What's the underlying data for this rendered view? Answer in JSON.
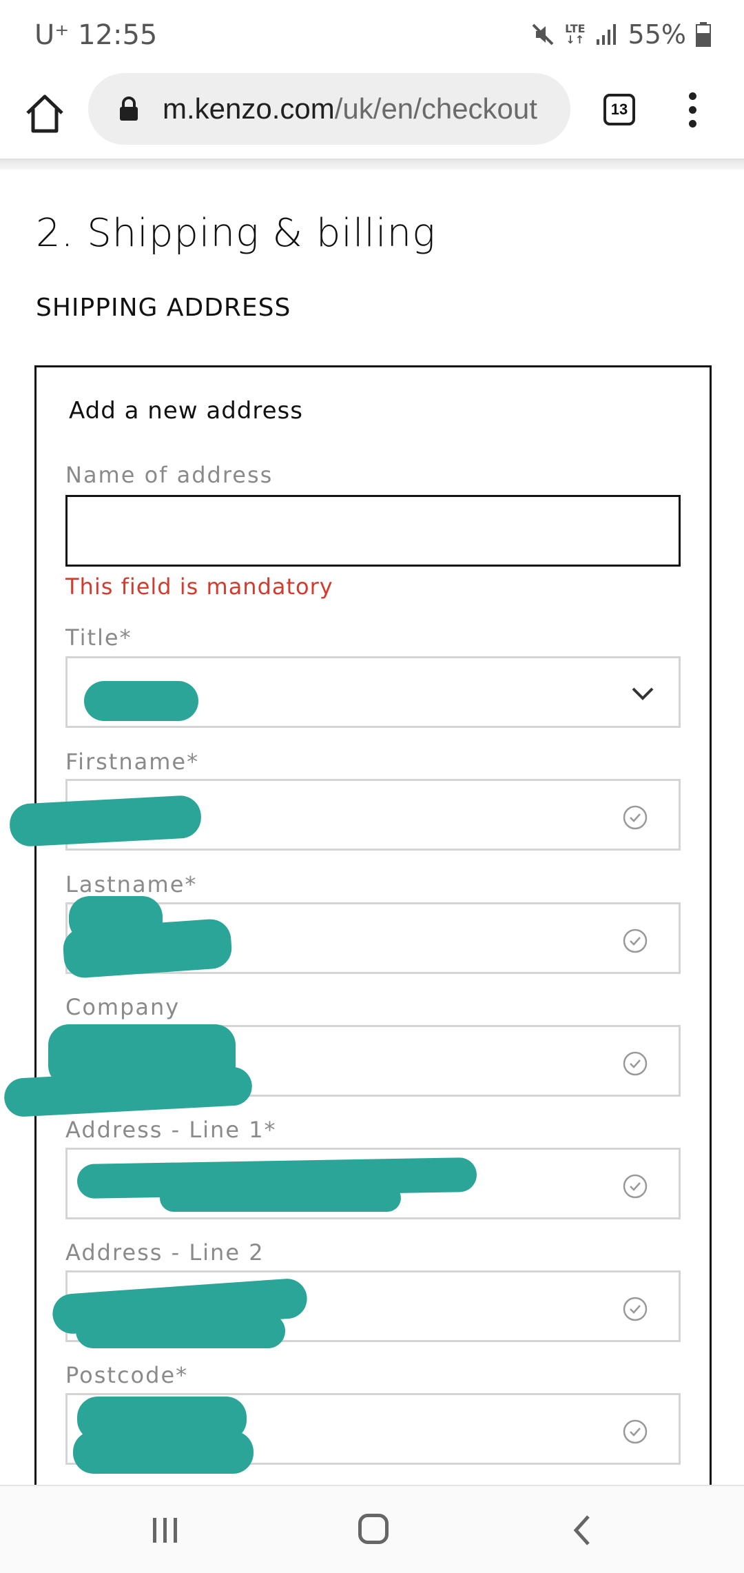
{
  "status_bar": {
    "carrier_time": "U⁺ 12:55",
    "network": "LTE",
    "battery": "55%"
  },
  "browser": {
    "url_host": "m.kenzo.com",
    "url_path": "/uk/en/checkout",
    "tab_count": "13"
  },
  "page": {
    "step_title": "2. Shipping & billing",
    "section_label": "SHIPPING ADDRESS"
  },
  "form": {
    "heading": "Add a new address",
    "name_of_address": {
      "label": "Name of address",
      "value": "",
      "error": "This field is mandatory"
    },
    "title": {
      "label": "Title*"
    },
    "firstname": {
      "label": "Firstname*"
    },
    "lastname": {
      "label": "Lastname*"
    },
    "company": {
      "label": "Company"
    },
    "address_line1": {
      "label": "Address - Line 1*"
    },
    "address_line2": {
      "label": "Address - Line 2"
    },
    "postcode": {
      "label": "Postcode*"
    }
  },
  "colors": {
    "error": "#d23c2e",
    "redaction": "#2ba597",
    "border_valid": "#d4d4d4",
    "border_active": "#111111"
  },
  "icons": [
    "home-icon",
    "lock-icon",
    "tabs-icon",
    "more-vert-icon",
    "check-circle-icon",
    "chevron-down-icon",
    "recent-apps-icon",
    "nav-home-icon",
    "back-icon",
    "mute-icon",
    "signal-icon",
    "battery-icon"
  ]
}
